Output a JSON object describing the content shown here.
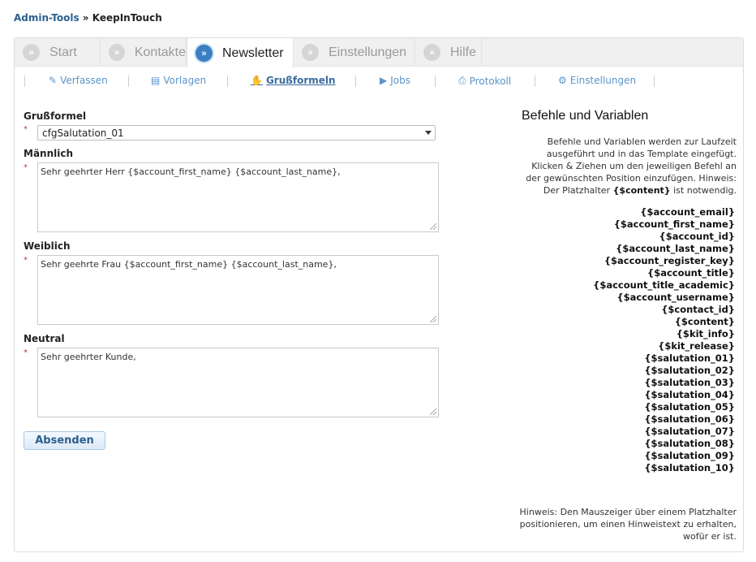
{
  "breadcrumb": {
    "parent": "Admin-Tools",
    "separator": "»",
    "current": "KeepInTouch"
  },
  "tabs": [
    {
      "label": "Start",
      "icon": "»"
    },
    {
      "label": "Kontakte",
      "icon": "»"
    },
    {
      "label": "Newsletter",
      "icon": "»",
      "active": true
    },
    {
      "label": "Einstellungen",
      "icon": "»"
    },
    {
      "label": "Hilfe",
      "icon": "»"
    }
  ],
  "subnav": [
    {
      "label": "Verfassen",
      "icon": "edit-icon",
      "glyph": "✎"
    },
    {
      "label": "Vorlagen",
      "icon": "template-icon",
      "glyph": "▤"
    },
    {
      "label": "Grußformeln",
      "icon": "hand-icon",
      "glyph": "✋",
      "active": true
    },
    {
      "label": "Jobs",
      "icon": "play-icon",
      "glyph": "▶"
    },
    {
      "label": "Protokoll",
      "icon": "print-icon",
      "glyph": "⎙"
    },
    {
      "label": "Einstellungen",
      "icon": "gears-icon",
      "glyph": "⚙"
    }
  ],
  "form": {
    "salutation_label": "Grußformel",
    "salutation_value": "cfgSalutation_01",
    "required_mark": "*",
    "male_label": "Männlich",
    "male_value": "Sehr geehrter Herr {$account_first_name} {$account_last_name},",
    "female_label": "Weiblich",
    "female_value": "Sehr geehrte Frau {$account_first_name} {$account_last_name},",
    "neutral_label": "Neutral",
    "neutral_value": "Sehr geehrter Kunde,",
    "submit_label": "Absenden"
  },
  "aside": {
    "title": "Befehle und Variablen",
    "desc_pre": "Befehle und Variablen werden zur Laufzeit ausgeführt und in das Template eingefügt. Klicken & Ziehen um den jeweiligen Befehl an der gewünschten Position einzufügen. Hinweis: Der Platzhalter ",
    "desc_token": "{$content}",
    "desc_post": " ist notwendig.",
    "variables": [
      "{$account_email}",
      "{$account_first_name}",
      "{$account_id}",
      "{$account_last_name}",
      "{$account_register_key}",
      "{$account_title}",
      "{$account_title_academic}",
      "{$account_username}",
      "{$contact_id}",
      "{$content}",
      "{$kit_info}",
      "{$kit_release}",
      "{$salutation_01}",
      "{$salutation_02}",
      "{$salutation_03}",
      "{$salutation_04}",
      "{$salutation_05}",
      "{$salutation_06}",
      "{$salutation_07}",
      "{$salutation_08}",
      "{$salutation_09}",
      "{$salutation_10}"
    ],
    "hint": "Hinweis: Den Mauszeiger über einem Platzhalter positionieren, um einen Hinweistext zu erhalten, wofür er ist."
  },
  "colors": {
    "accent": "#3a7fc1",
    "link": "#5b95c9",
    "required": "#c0392b"
  }
}
